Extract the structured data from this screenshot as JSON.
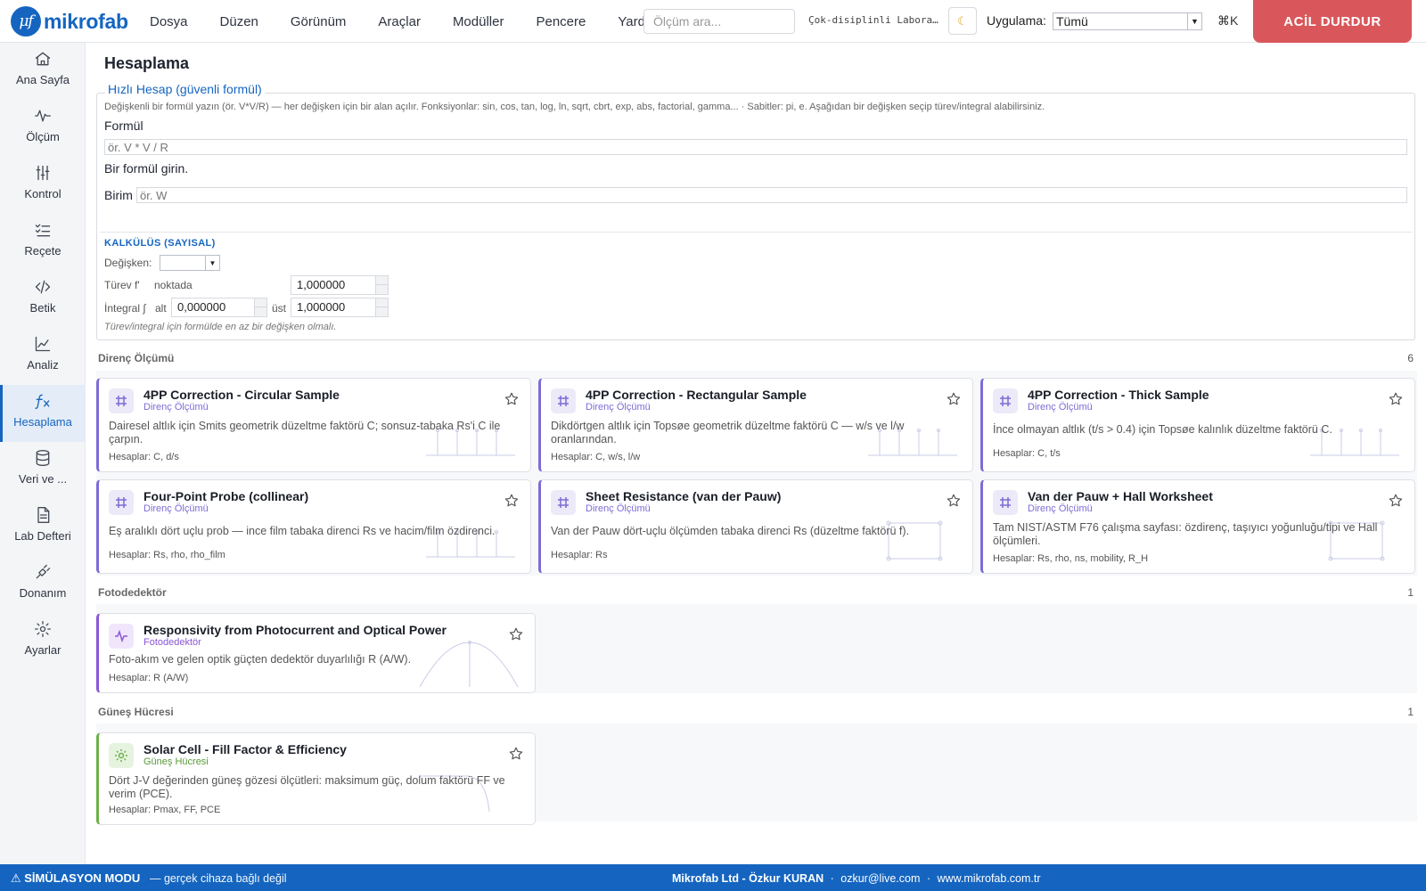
{
  "app": {
    "logo_mark": "μf",
    "logo_text": "mikrofab"
  },
  "menu": [
    "Dosya",
    "Düzen",
    "Görünüm",
    "Araçlar",
    "Modüller",
    "Pencere",
    "Yardım"
  ],
  "search": {
    "placeholder": "Ölçüm ara..."
  },
  "topbar": {
    "lab_name": "Çok-disiplinli Laboratuvar",
    "theme_icon": "moon-icon",
    "app_label": "Uygulama:",
    "app_value": "Tümü",
    "shortcut": "⌘K",
    "estop": "ACİL DURDUR"
  },
  "sidebar": [
    {
      "label": "Ana Sayfa",
      "icon": "home-icon"
    },
    {
      "label": "Ölçüm",
      "icon": "waveform-icon"
    },
    {
      "label": "Kontrol",
      "icon": "sliders-icon"
    },
    {
      "label": "Reçete",
      "icon": "checklist-icon"
    },
    {
      "label": "Betik",
      "icon": "code-icon"
    },
    {
      "label": "Analiz",
      "icon": "chart-icon"
    },
    {
      "label": "Hesaplama",
      "icon": "function-icon",
      "active": true
    },
    {
      "label": "Veri ve ...",
      "icon": "database-icon"
    },
    {
      "label": "Lab Defteri",
      "icon": "notebook-icon"
    },
    {
      "label": "Donanım",
      "icon": "plug-icon"
    },
    {
      "label": "Ayarlar",
      "icon": "gear-icon"
    }
  ],
  "page": {
    "title": "Hesaplama",
    "quick": {
      "legend": "Hızlı Hesap (güvenli formül)",
      "help": "Değişkenli bir formül yazın (ör. V*V/R) — her değişken için bir alan açılır. Fonksiyonlar: sin, cos, tan, log, ln, sqrt, cbrt, exp, abs, factorial, gamma... · Sabitler: pi, e. Aşağıdan bir değişken seçip türev/integral alabilirsiniz.",
      "formula_label": "Formül",
      "formula_placeholder": "ör. V * V / R",
      "message": "Bir formül girin.",
      "unit_label": "Birim",
      "unit_placeholder": "ör. W"
    },
    "calculus": {
      "title": "KALKÜLÜS (SAYISAL)",
      "variable_label": "Değişken:",
      "variable_value": "",
      "derivative_label": "Türev f'",
      "at_label": "noktada",
      "at_value": "1,000000",
      "integral_label": "İntegral ∫",
      "lower_label": "alt",
      "lower_value": "0,000000",
      "upper_label": "üst",
      "upper_value": "1,000000",
      "hint": "Türev/integral için formülde en az bir değişken olmalı."
    }
  },
  "groups": [
    {
      "name": "Direnç Ölçümü",
      "count": "6",
      "cards": [
        {
          "title": "4PP Correction - Circular Sample",
          "category": "Direnç Ölçümü",
          "desc": "Dairesel altlık için Smits geometrik düzeltme faktörü C; sonsuz-tabaka Rs'i C ile çarpın.",
          "calc": "Hesaplar: C, d/s",
          "icon": "grid-icon"
        },
        {
          "title": "4PP Correction - Rectangular Sample",
          "category": "Direnç Ölçümü",
          "desc": "Dikdörtgen altlık için Topsøe geometrik düzeltme faktörü C — w/s ve l/w oranlarından.",
          "calc": "Hesaplar: C, w/s, l/w",
          "icon": "grid-icon"
        },
        {
          "title": "4PP Correction - Thick Sample",
          "category": "Direnç Ölçümü",
          "desc": "İnce olmayan altlık (t/s > 0.4) için Topsøe kalınlık düzeltme faktörü C.",
          "calc": "Hesaplar: C, t/s",
          "icon": "grid-icon"
        },
        {
          "title": "Four-Point Probe (collinear)",
          "category": "Direnç Ölçümü",
          "desc": "Eş aralıklı dört uçlu prob — ince film tabaka direnci Rs ve hacim/film özdirenci.",
          "calc": "Hesaplar: Rs, rho, rho_film",
          "icon": "grid-icon"
        },
        {
          "title": "Sheet Resistance (van der Pauw)",
          "category": "Direnç Ölçümü",
          "desc": "Van der Pauw dört-uçlu ölçümden tabaka direnci Rs (düzeltme faktörü f).",
          "calc": "Hesaplar: Rs",
          "icon": "grid-icon"
        },
        {
          "title": "Van der Pauw + Hall Worksheet",
          "category": "Direnç Ölçümü",
          "desc": "Tam NIST/ASTM F76 çalışma sayfası: özdirenç, taşıyıcı yoğunluğu/tipi ve Hall ölçümleri.",
          "calc": "Hesaplar: Rs, rho, ns, mobility, R_H",
          "icon": "grid-icon"
        }
      ]
    },
    {
      "name": "Fotodedektör",
      "count": "1",
      "cards": [
        {
          "title": "Responsivity from Photocurrent and Optical Power",
          "category": "Fotodedektör",
          "desc": "Foto-akım ve gelen optik güçten dedektör duyarlılığı R (A/W).",
          "calc": "Hesaplar: R (A/W)",
          "icon": "pulse-icon"
        }
      ]
    },
    {
      "name": "Güneş Hücresi",
      "count": "1",
      "cards": [
        {
          "title": "Solar Cell - Fill Factor & Efficiency",
          "category": "Güneş Hücresi",
          "desc": "Dört J-V değerinden güneş gözesi ölçütleri: maksimum güç, dolum faktörü FF ve verim (PCE).",
          "calc": "Hesaplar: Pmax, FF, PCE",
          "icon": "sun-icon"
        }
      ]
    }
  ],
  "status": {
    "sim_label": "⚠ SİMÜLASYON MODU",
    "sim_sub": "— gerçek cihaza bağlı değil",
    "company": "Mikrofab Ltd - Özkur KURAN",
    "sep1": "·",
    "email": "ozkur@live.com",
    "sep2": "·",
    "website": "www.mikrofab.com.tr"
  }
}
